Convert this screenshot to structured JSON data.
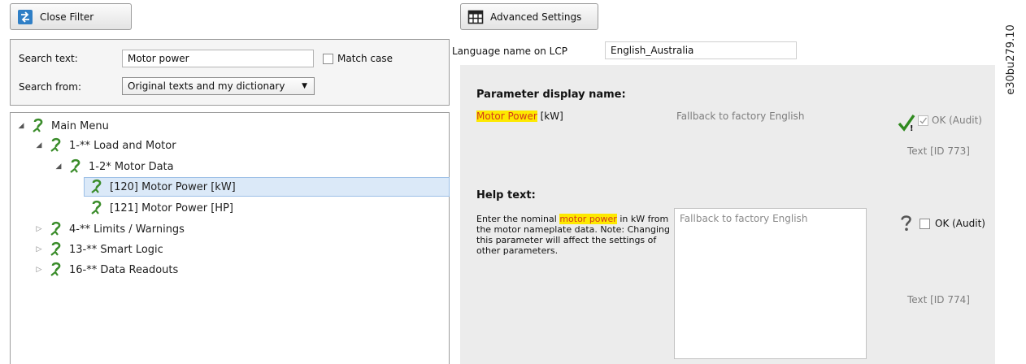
{
  "toolbar": {
    "close_filter_label": "Close Filter",
    "advanced_settings_label": "Advanced Settings"
  },
  "search": {
    "text_label": "Search text:",
    "text_value": "Motor power",
    "match_case_label": "Match case",
    "from_label": "Search from:",
    "from_value": "Original texts and my dictionary"
  },
  "tree": {
    "items": [
      {
        "label": "Main Menu"
      },
      {
        "label": "1-** Load and Motor"
      },
      {
        "label": "1-2* Motor Data"
      },
      {
        "label": "[120] Motor Power [kW]"
      },
      {
        "label": "[121] Motor Power [HP]"
      },
      {
        "label": "4-** Limits / Warnings"
      },
      {
        "label": "13-** Smart Logic"
      },
      {
        "label": "16-** Data Readouts"
      }
    ]
  },
  "language": {
    "label": "Language name on LCP",
    "value": "English_Australia"
  },
  "param_display": {
    "heading": "Parameter display name:",
    "name_highlight": "Motor Power",
    "name_rest": " [kW]",
    "fallback": "Fallback to factory English",
    "ok_label": "OK (Audit)",
    "text_id": "Text [ID 773]"
  },
  "help": {
    "heading": "Help text:",
    "text_before": "Enter the nominal ",
    "text_highlight": "motor power",
    "text_after": " in kW from the motor nameplate data. Note: Changing this parameter will affect the settings of other parameters.",
    "fallback": "Fallback to factory English",
    "ok_label": "OK (Audit)",
    "text_id": "Text [ID 774]"
  },
  "side_code": "e30bu279.10",
  "colors": {
    "highlight_bg": "#fde900",
    "highlight_fg": "#d43a1a",
    "selected_row": "#dbe9f8",
    "check_green": "#2f8a1f",
    "panel_grey": "#ececec"
  }
}
